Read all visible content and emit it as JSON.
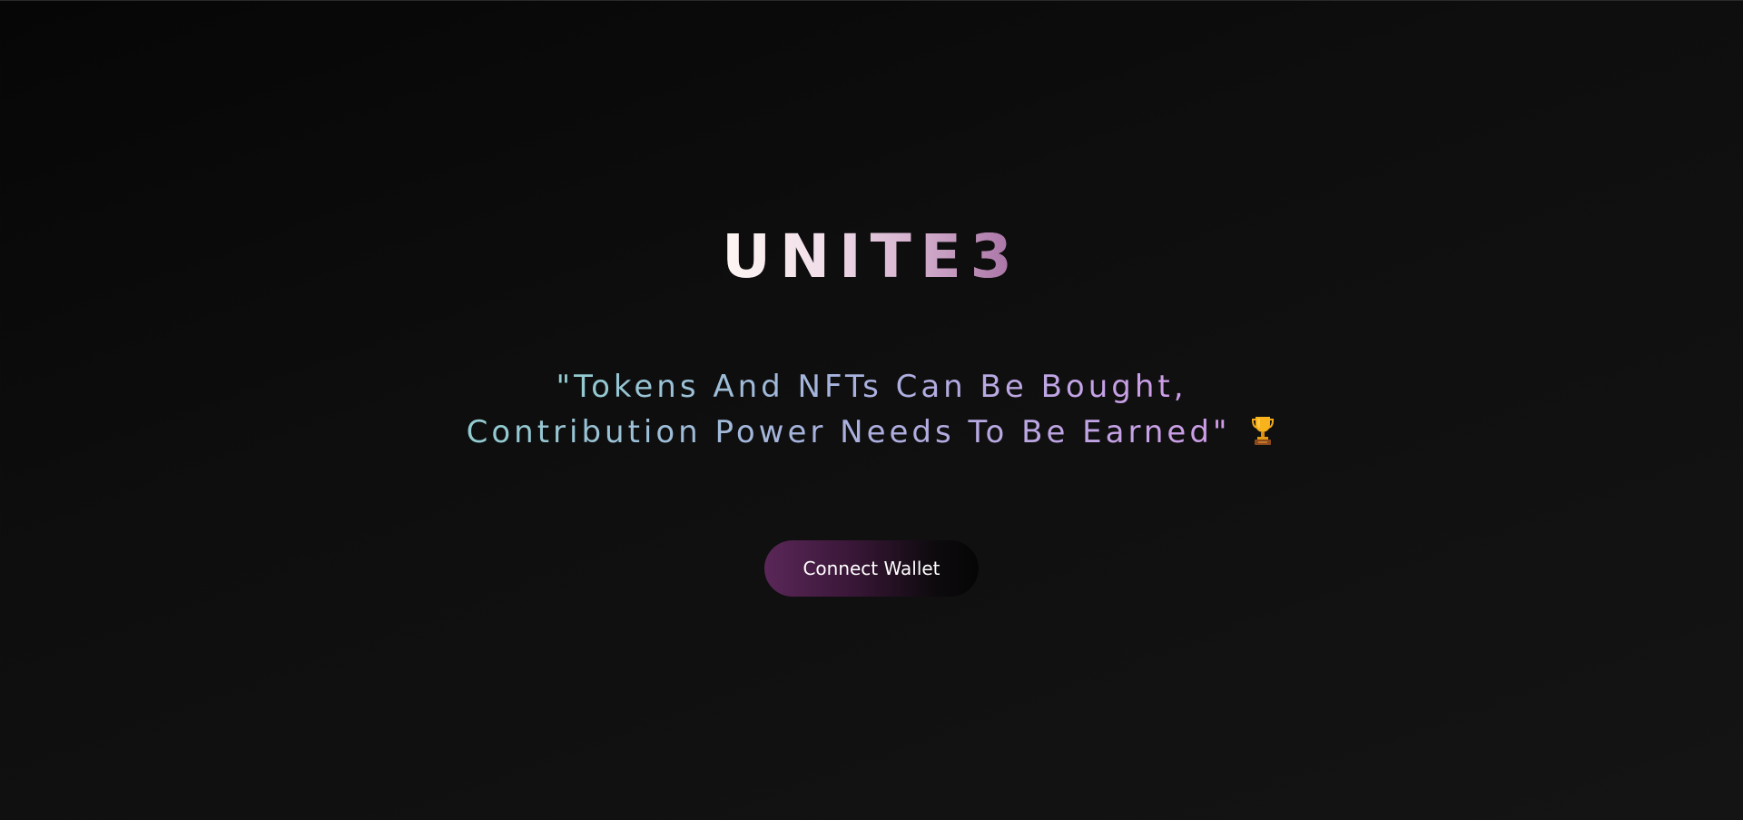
{
  "hero": {
    "brand_title": "UNITE3",
    "tagline": {
      "line1": "\"Tokens And NFTs Can Be Bought,",
      "line2": "Contribution Power Needs To Be Earned\"",
      "icon": "trophy-icon"
    },
    "connect_button_label": "Connect Wallet"
  },
  "colors": {
    "background": "#0e0e0e",
    "brand_gradient_start": "#fbf3f0",
    "brand_gradient_end": "#a872a4",
    "tagline_gradient_start": "#92ccd0",
    "tagline_gradient_end": "#cf9ce8",
    "button_gradient_start": "#5a2758",
    "button_gradient_end": "#060606",
    "trophy": "#f2a818"
  }
}
